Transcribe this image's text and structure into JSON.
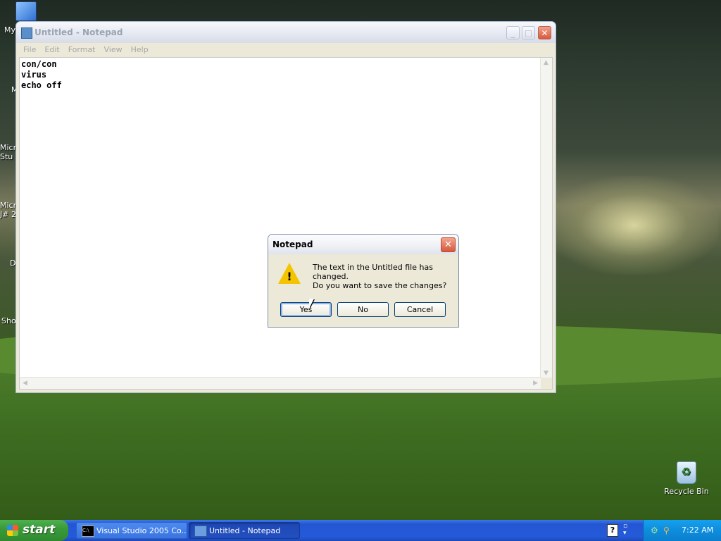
{
  "desktop": {
    "icons": [
      {
        "label": "My"
      },
      {
        "label": "M"
      },
      {
        "label": "Micr\nStu"
      },
      {
        "label": "Micr\nJ# 2"
      },
      {
        "label": "D"
      },
      {
        "label": "Sho"
      }
    ],
    "recycle_bin_label": "Recycle Bin"
  },
  "notepad": {
    "title": "Untitled - Notepad",
    "menu": [
      "File",
      "Edit",
      "Format",
      "View",
      "Help"
    ],
    "content": "con/con\nvirus\necho off"
  },
  "dialog": {
    "title": "Notepad",
    "message": "The text in the Untitled file has changed.",
    "question": "Do you want to save the changes?",
    "buttons": {
      "yes": "Yes",
      "no": "No",
      "cancel": "Cancel"
    },
    "icon": "warning-icon"
  },
  "taskbar": {
    "start_label": "start",
    "tasks": [
      "Visual Studio 2005 Co...",
      "Untitled - Notepad"
    ],
    "clock": "7:22 AM"
  }
}
